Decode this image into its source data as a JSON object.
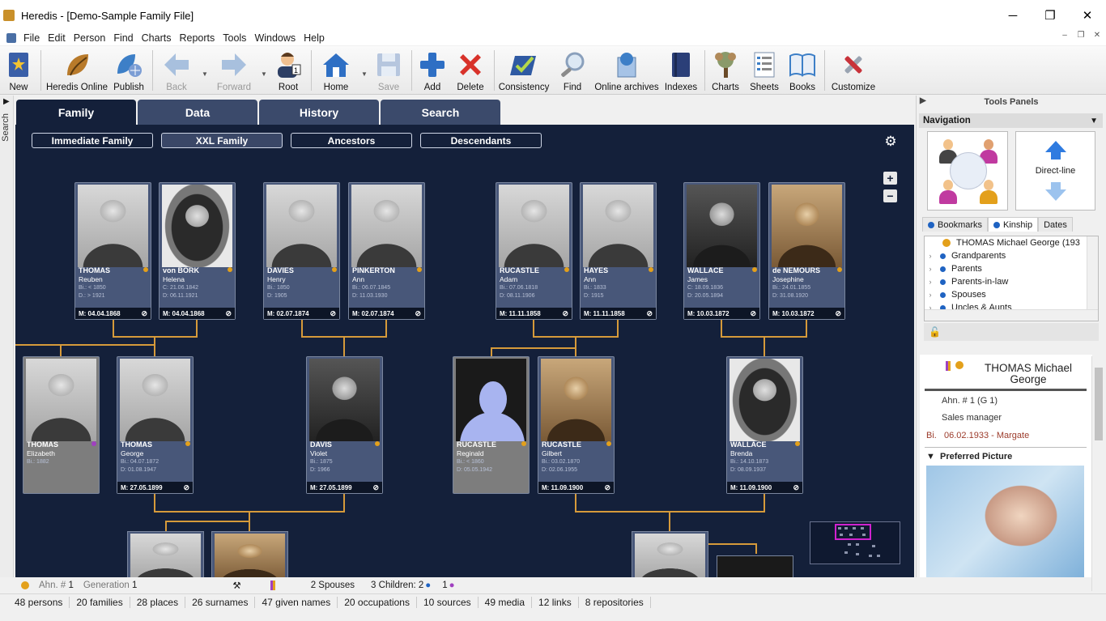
{
  "window": {
    "title": "Heredis - [Demo-Sample Family File]",
    "minimize": "─",
    "maximize": "❐",
    "close": "✕"
  },
  "menu": [
    "File",
    "Edit",
    "Person",
    "Find",
    "Charts",
    "Reports",
    "Tools",
    "Windows",
    "Help"
  ],
  "toolbar": [
    {
      "label": "New",
      "icon": "new-file-icon",
      "enabled": true
    },
    {
      "label": "Heredis Online",
      "icon": "heredis-online-icon",
      "enabled": true
    },
    {
      "label": "Publish",
      "icon": "publish-icon",
      "enabled": true
    },
    {
      "label": "Back",
      "icon": "back-arrow-icon",
      "enabled": false
    },
    {
      "label": "Forward",
      "icon": "forward-arrow-icon",
      "enabled": false
    },
    {
      "label": "Root",
      "icon": "root-person-icon",
      "enabled": true
    },
    {
      "label": "Home",
      "icon": "home-icon",
      "enabled": true
    },
    {
      "label": "Save",
      "icon": "save-icon",
      "enabled": false
    },
    {
      "label": "Add",
      "icon": "add-icon",
      "enabled": true
    },
    {
      "label": "Delete",
      "icon": "delete-icon",
      "enabled": true
    },
    {
      "label": "Consistency",
      "icon": "consistency-icon",
      "enabled": true
    },
    {
      "label": "Find",
      "icon": "find-icon",
      "enabled": true
    },
    {
      "label": "Online archives",
      "icon": "online-archives-icon",
      "enabled": true
    },
    {
      "label": "Indexes",
      "icon": "indexes-icon",
      "enabled": true
    },
    {
      "label": "Charts",
      "icon": "charts-tree-icon",
      "enabled": true
    },
    {
      "label": "Sheets",
      "icon": "sheets-icon",
      "enabled": true
    },
    {
      "label": "Books",
      "icon": "books-icon",
      "enabled": true
    },
    {
      "label": "Customize",
      "icon": "customize-icon",
      "enabled": true
    }
  ],
  "side_search_label": "Search",
  "tabs": [
    "Family",
    "Data",
    "History",
    "Search"
  ],
  "active_tab": "Family",
  "subtabs": [
    "Immediate Family",
    "XXL Family",
    "Ancestors",
    "Descendants"
  ],
  "active_subtab": "XXL Family",
  "cards": [
    {
      "surname": "THOMAS",
      "given": "Reuben",
      "l1": "Bi.: < 1850",
      "l2": "D.: > 1921",
      "foot": "M: 04.04.1868",
      "photo": "p-light",
      "mark": "o"
    },
    {
      "surname": "von BORK",
      "given": "Helena",
      "l1": "C: 21.06.1842",
      "l2": "D: 06.11.1921",
      "foot": "M: 04.04.1868",
      "photo": "p-oval",
      "mark": "o"
    },
    {
      "surname": "DAVIES",
      "given": "Henry",
      "l1": "Bi.: 1850",
      "l2": "D: 1905",
      "foot": "M: 02.07.1874",
      "photo": "p-light",
      "mark": "o"
    },
    {
      "surname": "PINKERTON",
      "given": "Ann",
      "l1": "Bi.: 06.07.1845",
      "l2": "D: 11.03.1930",
      "foot": "M: 02.07.1874",
      "photo": "p-light",
      "mark": "o"
    },
    {
      "surname": "RUCASTLE",
      "given": "Adam",
      "l1": "Bi.: 07.06.1818",
      "l2": "D: 08.11.1906",
      "foot": "M: 11.11.1858",
      "photo": "p-light",
      "mark": "o"
    },
    {
      "surname": "HAYES",
      "given": "Ann",
      "l1": "Bi.: 1833",
      "l2": "D: 1915",
      "foot": "M: 11.11.1858",
      "photo": "p-light",
      "mark": "o"
    },
    {
      "surname": "WALLACE",
      "given": "James",
      "l1": "C: 18.09.1836",
      "l2": "D: 20.05.1894",
      "foot": "M: 10.03.1872",
      "photo": "p-dark",
      "mark": "o"
    },
    {
      "surname": "de NEMOURS",
      "given": "Josephine",
      "l1": "Bi.: 24.01.1855",
      "l2": "D: 31.08.1920",
      "foot": "M: 10.03.1872",
      "photo": "p-sepia",
      "mark": "o"
    },
    {
      "surname": "THOMAS",
      "given": "Elizabeth",
      "l1": "Bi.: 1882",
      "l2": "",
      "foot": "",
      "photo": "p-light",
      "mark": "p",
      "grey": true
    },
    {
      "surname": "THOMAS",
      "given": "George",
      "l1": "Bi.: 04.07.1872",
      "l2": "D: 01.08.1947",
      "foot": "M: 27.05.1899",
      "photo": "p-light",
      "mark": "o"
    },
    {
      "surname": "DAVIS",
      "given": "Violet",
      "l1": "Bi.: 1875",
      "l2": "D: 1966",
      "foot": "M: 27.05.1899",
      "photo": "p-dark",
      "mark": "o"
    },
    {
      "surname": "RUCASTLE",
      "given": "Reginald",
      "l1": "Bi.: < 1860",
      "l2": "D: 05.05.1942",
      "foot": "",
      "photo": "p-silhouette",
      "mark": "o",
      "grey": true
    },
    {
      "surname": "RUCASTLE",
      "given": "Gilbert",
      "l1": "Bi.: 03.02.1870",
      "l2": "D: 02.06.1955",
      "foot": "M: 11.09.1900",
      "photo": "p-sepia",
      "mark": "o"
    },
    {
      "surname": "WALLACE",
      "given": "Brenda",
      "l1": "Bi.: 14.10.1873",
      "l2": "D: 08.09.1937",
      "foot": "M: 11.09.1900",
      "photo": "p-oval",
      "mark": "o"
    }
  ],
  "tools_panel": {
    "title": "Tools Panels",
    "navigation": "Navigation",
    "direct_line": "Direct-line",
    "tabs": [
      "Bookmarks",
      "Kinship",
      "Dates"
    ],
    "kinship_items": [
      "THOMAS Michael George (193",
      "Grandparents",
      "Parents",
      "Parents-in-law",
      "Spouses",
      "Uncles & Aunts"
    ],
    "person_name": "THOMAS Michael George",
    "ahn": "Ahn. # 1 (G 1)",
    "occupation": "Sales manager",
    "birth_label": "Bi.",
    "birth": "06.02.1933 - Margate",
    "preferred_picture": "Preferred Picture"
  },
  "status1": {
    "ahn_label": "Ahn. #",
    "ahn": "1",
    "gen_label": "Generation",
    "gen": "1",
    "spouses": "2 Spouses",
    "children": "3 Children: 2",
    "female": "1"
  },
  "status2": [
    "48 persons",
    "20 families",
    "28 places",
    "26 surnames",
    "47 given names",
    "20  occupations",
    "10 sources",
    "49  media",
    "12 links",
    "8 repositories"
  ]
}
